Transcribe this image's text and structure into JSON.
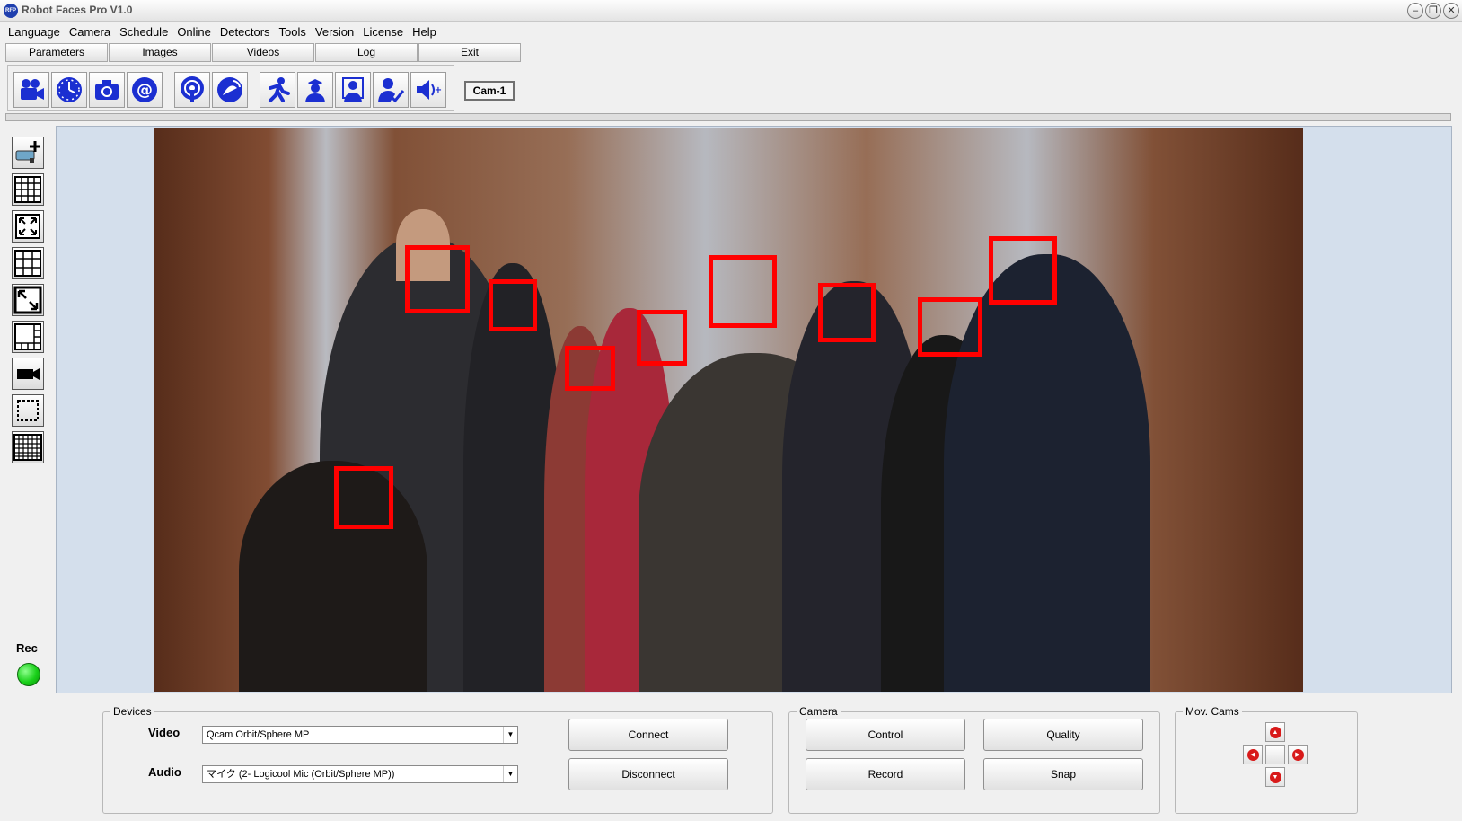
{
  "window": {
    "title": "Robot Faces Pro V1.0",
    "icon_text": "RFP",
    "controls": [
      "–",
      "❐",
      "✕"
    ]
  },
  "menu": [
    "Language",
    "Camera",
    "Schedule",
    "Online",
    "Detectors",
    "Tools",
    "Version",
    "License",
    "Help"
  ],
  "tabs": [
    "Parameters",
    "Images",
    "Videos",
    "Log",
    "Exit"
  ],
  "toolbar": {
    "buttons": [
      "video-camera-icon",
      "clock-icon",
      "photo-camera-icon",
      "email-icon",
      "broadcast-icon",
      "satellite-dish-icon",
      "running-man-icon",
      "police-officer-icon",
      "person-id-icon",
      "user-check-icon",
      "speaker-volume-icon"
    ],
    "camera_label": "Cam-1"
  },
  "sidebar": {
    "buttons": [
      "add-camera-icon",
      "grid-4x4-icon",
      "fullscreen-icon",
      "grid-3x3-icon",
      "fullscreen-bold-icon",
      "filmstrip-grid-icon",
      "single-camera-icon",
      "selection-box-icon",
      "many-grid-icon"
    ],
    "rec_label": "Rec",
    "rec_color": "#19d019"
  },
  "video": {
    "face_box_color": "#ff0000",
    "faces_detected": 10
  },
  "devices": {
    "group_title": "Devices",
    "video_label": "Video",
    "video_value": "Qcam Orbit/Sphere MP",
    "audio_label": "Audio",
    "audio_value": "マイク (2- Logicool Mic (Orbit/Sphere MP))",
    "connect_label": "Connect",
    "disconnect_label": "Disconnect"
  },
  "camera_group": {
    "group_title": "Camera",
    "control_label": "Control",
    "quality_label": "Quality",
    "record_label": "Record",
    "snap_label": "Snap"
  },
  "mov_cams": {
    "group_title": "Mov. Cams"
  }
}
